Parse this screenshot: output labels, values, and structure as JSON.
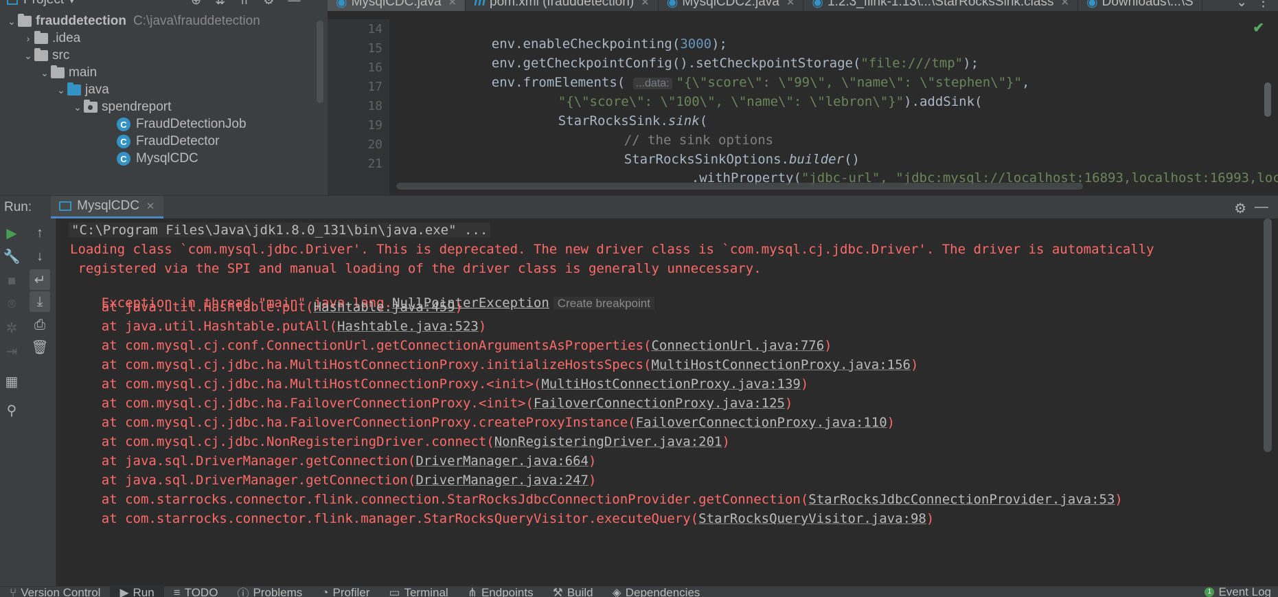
{
  "project": {
    "title": "Project",
    "root_name": "frauddetection",
    "root_path": "C:\\java\\frauddetection",
    "items": [
      {
        "label": ".idea"
      },
      {
        "label": "src"
      },
      {
        "label": "main"
      },
      {
        "label": "java"
      },
      {
        "label": "spendreport"
      },
      {
        "label": "FraudDetectionJob"
      },
      {
        "label": "FraudDetector"
      },
      {
        "label": "MysqlCDC"
      }
    ]
  },
  "editor": {
    "tabs": [
      {
        "label": "MysqlCDC.java",
        "icon": "class-icon"
      },
      {
        "label": "pom.xml (frauddetection)",
        "icon": "maven-icon"
      },
      {
        "label": "MysqlCDC2.java",
        "icon": "class-icon"
      },
      {
        "label": "1.2.3_flink-1.13\\...\\StarRocksSink.class",
        "icon": "class-icon"
      },
      {
        "label": "Downloads\\...\\S",
        "icon": "class-icon"
      }
    ],
    "lines": [
      {
        "num": "14"
      },
      {
        "num": "15"
      },
      {
        "num": "16"
      },
      {
        "num": "17"
      },
      {
        "num": "18"
      },
      {
        "num": "19"
      },
      {
        "num": "20"
      },
      {
        "num": "21"
      }
    ],
    "code": {
      "l14_a": "env.enableCheckpointing(",
      "l14_num": "3000",
      "l14_b": ");",
      "l15_a": "env.getCheckpointConfig().setCheckpointStorage(",
      "l15_str": "\"file:///tmp\"",
      "l15_b": ");",
      "l16_a": "env.fromElements(",
      "l16_hint": "...data:",
      "l16_str": "\"{\\\"score\\\": \\\"99\\\", \\\"name\\\": \\\"stephen\\\"}\"",
      "l16_b": ",",
      "l17_str": "\"{\\\"score\\\": \\\"100\\\", \\\"name\\\": \\\"lebron\\\"}\"",
      "l17_b": ").addSink(",
      "l18_a": "StarRocksSink.",
      "l18_i": "sink",
      "l18_b": "(",
      "l19_cmt": "// the sink options",
      "l20_a": "StarRocksSinkOptions.",
      "l20_i": "builder",
      "l20_b": "()",
      "l21_a": ".withProperty(",
      "l21_str": "\"jdbc-url\", \"jdbc:mysql://localhost:16893,localhost:16993,loc"
    }
  },
  "run": {
    "title": "Run:",
    "tab_label": "MysqlCDC",
    "console": {
      "cmd": "\"C:\\Program Files\\Java\\jdk1.8.0_131\\bin\\java.exe\" ...",
      "warn1": "Loading class `com.mysql.jdbc.Driver'. This is deprecated. The new driver class is `com.mysql.cj.jdbc.Driver'. The driver is automatically",
      "warn2": " registered via the SPI and manual loading of the driver class is generally unnecessary.",
      "exc_prefix": "Exception in thread \"main\" java.lang.",
      "exc_name": "NullPointerException",
      "create_breakpoint": "Create breakpoint",
      "frames": [
        {
          "method": "    at java.util.Hashtable.put(",
          "loc": "Hashtable.java:459"
        },
        {
          "method": "    at java.util.Hashtable.putAll(",
          "loc": "Hashtable.java:523"
        },
        {
          "method": "    at com.mysql.cj.conf.ConnectionUrl.getConnectionArgumentsAsProperties(",
          "loc": "ConnectionUrl.java:776"
        },
        {
          "method": "    at com.mysql.cj.jdbc.ha.MultiHostConnectionProxy.initializeHostsSpecs(",
          "loc": "MultiHostConnectionProxy.java:156"
        },
        {
          "method": "    at com.mysql.cj.jdbc.ha.MultiHostConnectionProxy.<init>(",
          "loc": "MultiHostConnectionProxy.java:139"
        },
        {
          "method": "    at com.mysql.cj.jdbc.ha.FailoverConnectionProxy.<init>(",
          "loc": "FailoverConnectionProxy.java:125"
        },
        {
          "method": "    at com.mysql.cj.jdbc.ha.FailoverConnectionProxy.createProxyInstance(",
          "loc": "FailoverConnectionProxy.java:110"
        },
        {
          "method": "    at com.mysql.cj.jdbc.NonRegisteringDriver.connect(",
          "loc": "NonRegisteringDriver.java:201"
        },
        {
          "method": "    at java.sql.DriverManager.getConnection(",
          "loc": "DriverManager.java:664"
        },
        {
          "method": "    at java.sql.DriverManager.getConnection(",
          "loc": "DriverManager.java:247"
        },
        {
          "method": "    at com.starrocks.connector.flink.connection.StarRocksJdbcConnectionProvider.getConnection(",
          "loc": "StarRocksJdbcConnectionProvider.java:53"
        },
        {
          "method": "    at com.starrocks.connector.flink.manager.StarRocksQueryVisitor.executeQuery(",
          "loc": "StarRocksQueryVisitor.java:98"
        }
      ],
      "close_paren": ")"
    }
  },
  "status_bar": {
    "items": [
      {
        "label": "Version Control"
      },
      {
        "label": "Run"
      },
      {
        "label": "TODO"
      },
      {
        "label": "Problems"
      },
      {
        "label": "Profiler"
      },
      {
        "label": "Terminal"
      },
      {
        "label": "Endpoints"
      },
      {
        "label": "Build"
      },
      {
        "label": "Dependencies"
      }
    ],
    "event_log": "Event Log",
    "event_count": "1"
  },
  "colors": {
    "error_text": "#ff6b68",
    "link_text": "#bbbbbb",
    "string": "#6a8759",
    "number": "#6897bb",
    "comment": "#808080",
    "accent_blue": "#3592c4",
    "run_green": "#499c54"
  }
}
